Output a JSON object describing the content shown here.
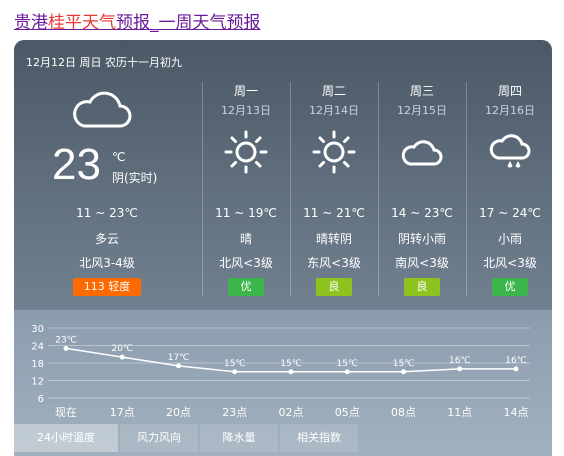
{
  "title": {
    "prefix": "贵港",
    "highlight": "桂平天气",
    "suffix": "预报_一周天气预报"
  },
  "header": {
    "date_line": "12月12日 周日 农历十一月初九"
  },
  "today": {
    "icon": "cloudy-icon",
    "temp": "23",
    "unit": "℃",
    "realtime": "阴(实时)",
    "range": "11 ~ 23℃",
    "desc": "多云",
    "wind": "北风3-4级",
    "aqi": "113 轻度",
    "aqi_color": "#ff6a00"
  },
  "days": [
    {
      "weekday": "周一",
      "date": "12月13日",
      "icon": "sunny-icon",
      "range": "11 ~ 19℃",
      "desc": "晴",
      "wind": "北风<3级",
      "aqi": "优",
      "aqi_color": "#3cb54a"
    },
    {
      "weekday": "周二",
      "date": "12月14日",
      "icon": "sunny-icon",
      "range": "11 ~ 21℃",
      "desc": "晴转阴",
      "wind": "东风<3级",
      "aqi": "良",
      "aqi_color": "#8dc21f"
    },
    {
      "weekday": "周三",
      "date": "12月15日",
      "icon": "cloudy-icon",
      "range": "14 ~ 23℃",
      "desc": "阴转小雨",
      "wind": "南风<3级",
      "aqi": "良",
      "aqi_color": "#8dc21f"
    },
    {
      "weekday": "周四",
      "date": "12月16日",
      "icon": "light-rain-icon",
      "range": "17 ~ 24℃",
      "desc": "小雨",
      "wind": "北风<3级",
      "aqi": "优",
      "aqi_color": "#3cb54a"
    }
  ],
  "chart_data": {
    "type": "line",
    "categories": [
      "现在",
      "17点",
      "20点",
      "23点",
      "02点",
      "05点",
      "08点",
      "11点",
      "14点"
    ],
    "series": [
      {
        "values": [
          23,
          20,
          17,
          15,
          15,
          15,
          15,
          16,
          16
        ]
      }
    ],
    "value_labels": [
      "23℃",
      "20℃",
      "17℃",
      "15℃",
      "15℃",
      "15℃",
      "15℃",
      "16℃",
      "16℃"
    ],
    "yticks": [
      30,
      24,
      18,
      12,
      6
    ],
    "ylim": [
      6,
      30
    ],
    "grid": true
  },
  "tabs": [
    {
      "label": "24小时温度",
      "active": true
    },
    {
      "label": "风力风向",
      "active": false
    },
    {
      "label": "降水量",
      "active": false
    },
    {
      "label": "相关指数",
      "active": false
    }
  ]
}
